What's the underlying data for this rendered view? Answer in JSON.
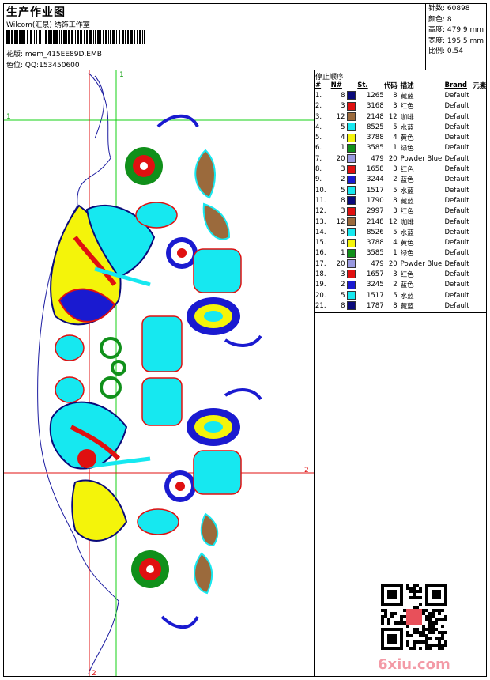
{
  "header": {
    "title": "生产作业图",
    "studio": "Wilcom(汇泉) 绣饰工作室",
    "pattern": "花版: mem_415EE89D.EMB",
    "qq": "色位: QQ:153450600"
  },
  "stats": {
    "stitches": "针数: 60898",
    "colors": "颜色: 8",
    "height": "高度: 479.9 mm",
    "width": "宽度: 195.5 mm",
    "scale": "比例: 0.54"
  },
  "sequence": {
    "title": "停止顺序:",
    "headers": [
      "#",
      "N#",
      "",
      "St.",
      "代码",
      "描述",
      "Brand",
      "元素"
    ],
    "rows": [
      {
        "idx": "1.",
        "n": "8",
        "color": "#0a0a7a",
        "st": "1265",
        "code": "8",
        "desc": "藏蓝",
        "brand": "Default"
      },
      {
        "idx": "2.",
        "n": "3",
        "color": "#e01010",
        "st": "3168",
        "code": "3",
        "desc": "红色",
        "brand": "Default"
      },
      {
        "idx": "3.",
        "n": "12",
        "color": "#9b6a3c",
        "st": "2148",
        "code": "12",
        "desc": "咖啡",
        "brand": "Default"
      },
      {
        "idx": "4.",
        "n": "5",
        "color": "#16e8f0",
        "st": "8525",
        "code": "5",
        "desc": "水蓝",
        "brand": "Default"
      },
      {
        "idx": "5.",
        "n": "4",
        "color": "#f4f40a",
        "st": "3788",
        "code": "4",
        "desc": "黄色",
        "brand": "Default"
      },
      {
        "idx": "6.",
        "n": "1",
        "color": "#10901a",
        "st": "3585",
        "code": "1",
        "desc": "绿色",
        "brand": "Default"
      },
      {
        "idx": "7.",
        "n": "20",
        "color": "#9999e0",
        "st": "479",
        "code": "20",
        "desc": "Powder Blue",
        "brand": "Default"
      },
      {
        "idx": "8.",
        "n": "3",
        "color": "#e01010",
        "st": "1658",
        "code": "3",
        "desc": "红色",
        "brand": "Default"
      },
      {
        "idx": "9.",
        "n": "2",
        "color": "#1a1ad0",
        "st": "3244",
        "code": "2",
        "desc": "蓝色",
        "brand": "Default"
      },
      {
        "idx": "10.",
        "n": "5",
        "color": "#16e8f0",
        "st": "1517",
        "code": "5",
        "desc": "水蓝",
        "brand": "Default"
      },
      {
        "idx": "11.",
        "n": "8",
        "color": "#0a0a7a",
        "st": "1790",
        "code": "8",
        "desc": "藏蓝",
        "brand": "Default"
      },
      {
        "idx": "12.",
        "n": "3",
        "color": "#e01010",
        "st": "2997",
        "code": "3",
        "desc": "红色",
        "brand": "Default"
      },
      {
        "idx": "13.",
        "n": "12",
        "color": "#9b6a3c",
        "st": "2148",
        "code": "12",
        "desc": "咖啡",
        "brand": "Default"
      },
      {
        "idx": "14.",
        "n": "5",
        "color": "#16e8f0",
        "st": "8526",
        "code": "5",
        "desc": "水蓝",
        "brand": "Default"
      },
      {
        "idx": "15.",
        "n": "4",
        "color": "#f4f40a",
        "st": "3788",
        "code": "4",
        "desc": "黄色",
        "brand": "Default"
      },
      {
        "idx": "16.",
        "n": "1",
        "color": "#10901a",
        "st": "3585",
        "code": "1",
        "desc": "绿色",
        "brand": "Default"
      },
      {
        "idx": "17.",
        "n": "20",
        "color": "#9999e0",
        "st": "479",
        "code": "20",
        "desc": "Powder Blue",
        "brand": "Default"
      },
      {
        "idx": "18.",
        "n": "3",
        "color": "#e01010",
        "st": "1657",
        "code": "3",
        "desc": "红色",
        "brand": "Default"
      },
      {
        "idx": "19.",
        "n": "2",
        "color": "#1a1ad0",
        "st": "3245",
        "code": "2",
        "desc": "蓝色",
        "brand": "Default"
      },
      {
        "idx": "20.",
        "n": "5",
        "color": "#16e8f0",
        "st": "1517",
        "code": "5",
        "desc": "水蓝",
        "brand": "Default"
      },
      {
        "idx": "21.",
        "n": "8",
        "color": "#0a0a7a",
        "st": "1787",
        "code": "8",
        "desc": "藏蓝",
        "brand": "Default"
      }
    ]
  },
  "guides": {
    "v1": "1",
    "h1": "1",
    "h2": "2",
    "v2": "2"
  },
  "watermark": "6xiu.com"
}
